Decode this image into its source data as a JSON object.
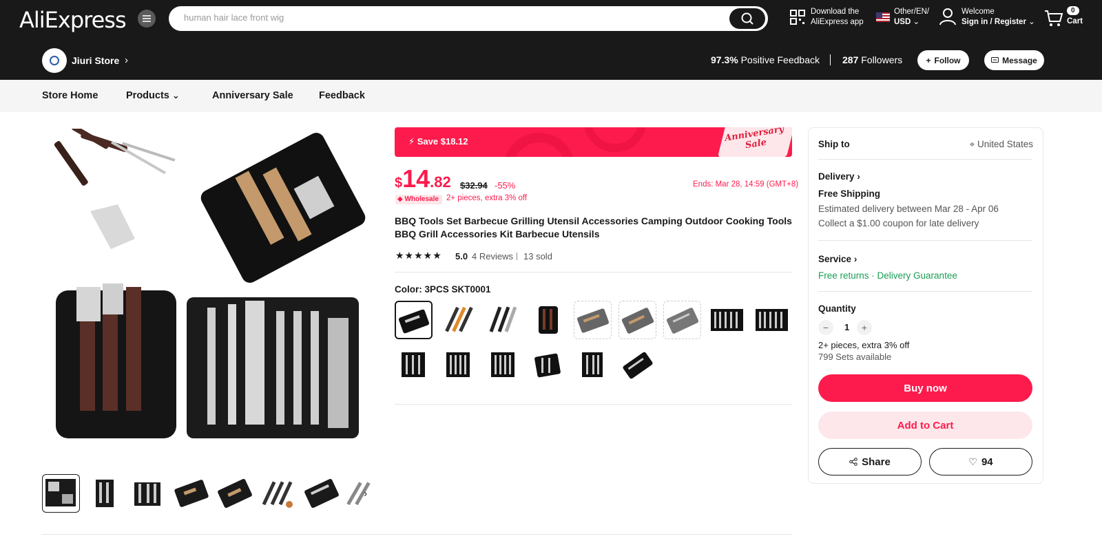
{
  "header": {
    "logo": "AliExpress",
    "search_placeholder": "human hair lace front wig",
    "app_line1": "Download the",
    "app_line2": "AliExpress app",
    "lang_line1": "Other/EN/",
    "lang_line2": "USD",
    "welcome": "Welcome",
    "signin": "Sign in / Register",
    "cart_count": "0",
    "cart_label": "Cart"
  },
  "store": {
    "name": "Jiuri Store",
    "feedback_pct": "97.3%",
    "feedback_label": "Positive Feedback",
    "followers_count": "287",
    "followers_label": "Followers",
    "follow_label": "Follow",
    "message_label": "Message"
  },
  "storenav": {
    "items": [
      "Store Home",
      "Products",
      "Anniversary Sale",
      "Feedback"
    ]
  },
  "promo": {
    "save_text": "Save $18.12",
    "tag_line1": "Anniversary",
    "tag_line2": "Sale"
  },
  "price": {
    "currency": "$",
    "integer": "14",
    "decimal": ".82",
    "original": "$32.94",
    "discount": "-55%",
    "ends": "Ends: Mar 28, 14:59 (GMT+8)",
    "wholesale_badge": "Wholesale",
    "wholesale_text": "2+ pieces, extra 3% off"
  },
  "product": {
    "title": "BBQ Tools Set Barbecue Grilling Utensil Accessories Camping Outdoor Cooking Tools BBQ Grill Accessories Kit Barbecue Utensils",
    "stars": "★★★★★",
    "rating": "5.0",
    "reviews": "4 Reviews",
    "sold": "13 sold",
    "color_label": "Color: 3PCS SKT0001"
  },
  "panel": {
    "ship_to_label": "Ship to",
    "ship_to_value": "United States",
    "delivery_label": "Delivery",
    "free_shipping": "Free Shipping",
    "estimate": "Estimated delivery between Mar 28 - Apr 06",
    "coupon": "Collect a $1.00 coupon for late delivery",
    "service_label": "Service",
    "free_returns": "Free returns",
    "service_sep": " · ",
    "guarantee": "Delivery Guarantee",
    "quantity_label": "Quantity",
    "quantity_value": "1",
    "pieces_note": "2+ pieces, extra 3% off",
    "available": "799 Sets available",
    "buy_now": "Buy now",
    "add_to_cart": "Add to Cart",
    "share": "Share",
    "wishlist_count": "94"
  },
  "colors": {
    "brand_red": "#fd1b4d",
    "header_bg": "#191919",
    "green": "#1a9e55"
  }
}
